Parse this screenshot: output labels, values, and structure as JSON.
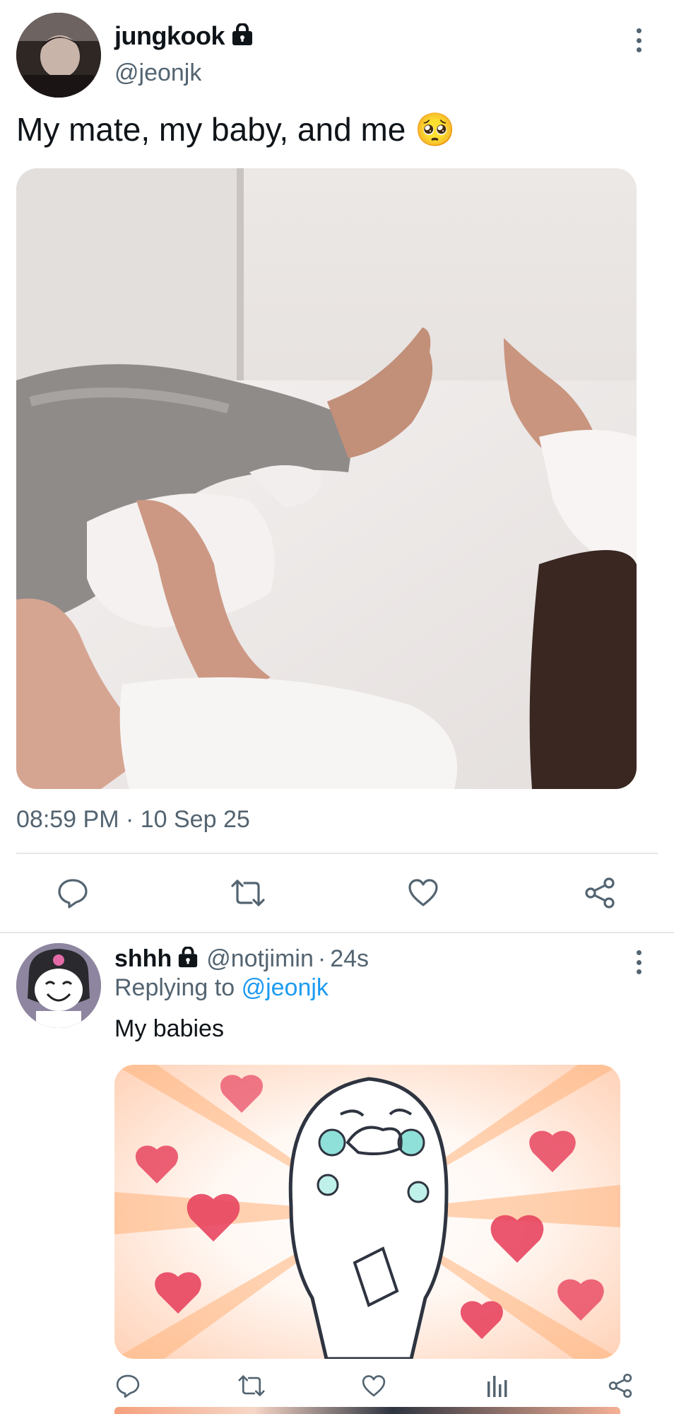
{
  "tweet": {
    "author_name": "jungkook",
    "author_handle": "@jeonjk",
    "text": "My mate, my baby, and me",
    "emoji": "🥺",
    "timestamp": "08:59 PM · 10 Sep 25",
    "icons": {
      "lock": "lock-icon",
      "more": "more-options-icon",
      "reply": "reply-icon",
      "retweet": "retweet-icon",
      "like": "like-icon",
      "share": "share-icon"
    }
  },
  "reply": {
    "author_name": "shhh",
    "author_handle": "@notjimin",
    "separator": "·",
    "time_ago": "24s",
    "replying_prefix": "Replying to",
    "replying_handle": "@jeonjk",
    "text": "My babies",
    "icons": {
      "reply": "reply-icon",
      "retweet": "retweet-icon",
      "like": "like-icon",
      "analytics": "analytics-icon",
      "share": "share-icon"
    }
  },
  "colors": {
    "text": "#0f1419",
    "muted": "#536471",
    "link": "#1d9bf0",
    "divider": "#e6e6e6"
  }
}
